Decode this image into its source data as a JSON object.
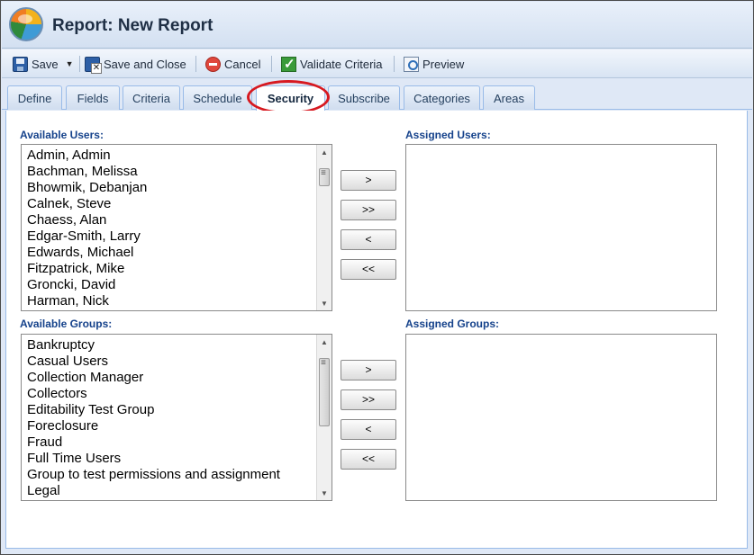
{
  "window": {
    "title": "Report: New Report"
  },
  "toolbar": {
    "save_label": "Save",
    "save_close_label": "Save and Close",
    "cancel_label": "Cancel",
    "validate_label": "Validate Criteria",
    "preview_label": "Preview"
  },
  "tabs": [
    {
      "label": "Define"
    },
    {
      "label": "Fields"
    },
    {
      "label": "Criteria"
    },
    {
      "label": "Schedule"
    },
    {
      "label": "Security",
      "active": true
    },
    {
      "label": "Subscribe"
    },
    {
      "label": "Categories"
    },
    {
      "label": "Areas"
    }
  ],
  "users": {
    "available_label": "Available Users:",
    "assigned_label": "Assigned Users:",
    "available": [
      "Admin, Admin",
      "Bachman, Melissa",
      "Bhowmik, Debanjan",
      "Calnek, Steve",
      "Chaess, Alan",
      "Edgar-Smith, Larry",
      "Edwards, Michael",
      "Fitzpatrick, Mike",
      "Groncki, David",
      "Harman, Nick"
    ]
  },
  "groups": {
    "available_label": "Available Groups:",
    "assigned_label": "Assigned Groups:",
    "available": [
      "Bankruptcy",
      "Casual Users",
      "Collection Manager",
      "Collectors",
      "Editability Test Group",
      "Foreclosure",
      "Fraud",
      "Full Time Users",
      "Group to test permissions and assignment",
      "Legal"
    ]
  },
  "move_buttons": {
    "add": ">",
    "add_all": ">>",
    "remove": "<",
    "remove_all": "<<"
  },
  "colors": {
    "highlight_ring": "#d71920",
    "section_label": "#15428b",
    "tab_border": "#99bbe8"
  }
}
